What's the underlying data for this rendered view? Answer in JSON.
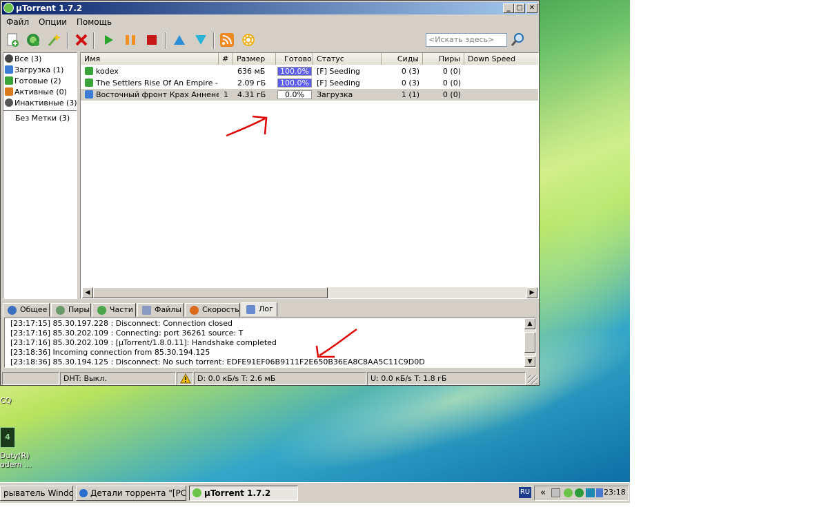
{
  "window": {
    "title": "µTorrent 1.7.2",
    "minimize": "_",
    "maximize": "□",
    "close": "✕"
  },
  "menu": [
    "Файл",
    "Опции",
    "Помощь"
  ],
  "toolbar": {
    "search_placeholder": "<Искать здесь>",
    "icons": [
      "add-torrent-icon",
      "add-url-icon",
      "create-torrent-icon",
      "remove-icon",
      "start-icon",
      "pause-icon",
      "stop-icon",
      "move-up-icon",
      "move-down-icon",
      "rss-icon",
      "settings-icon",
      "search-icon"
    ]
  },
  "sidebar": {
    "items": [
      {
        "label": "Все (3)",
        "color": "#444444"
      },
      {
        "label": "Загрузка (1)",
        "color": "#3a7bd5"
      },
      {
        "label": "Готовые (2)",
        "color": "#3aa43a"
      },
      {
        "label": "Активные (0)",
        "color": "#d97a1c"
      },
      {
        "label": "Инактивные (3)",
        "color": "#555555"
      }
    ],
    "labels_item": "Без Метки (3)"
  },
  "torrents": {
    "columns": [
      "Имя",
      "#",
      "Размер",
      "Готово",
      "Статус",
      "Сиды",
      "Пиры",
      "Down Speed"
    ],
    "rows": [
      {
        "name": "kodex",
        "num": "",
        "size": "636 мБ",
        "done": "100.0%",
        "done_fraction": 1.0,
        "status": "[F] Seeding",
        "seeds": "0 (3)",
        "peers": "0 (0)",
        "icon": "seeding-icon"
      },
      {
        "name": "The Settlers Rise Of An Empire - T...",
        "num": "",
        "size": "2.09 гБ",
        "done": "100.0%",
        "done_fraction": 1.0,
        "status": "[F] Seeding",
        "seeds": "0 (3)",
        "peers": "0 (0)",
        "icon": "seeding-icon"
      },
      {
        "name": "Восточный фронт Крах Анненербе",
        "num": "1",
        "size": "4.31 гБ",
        "done": "0.0%",
        "done_fraction": 0.0,
        "status": "Загрузка",
        "seeds": "1 (1)",
        "peers": "0 (0)",
        "icon": "downloading-icon"
      }
    ]
  },
  "tabs": [
    "Общее",
    "Пиры",
    "Части",
    "Файлы",
    "Скорость",
    "Лог"
  ],
  "log": [
    "[23:17:15]  85.30.197.228   : Disconnect: Connection closed",
    "[23:17:16]  85.30.202.109   : Connecting: port 36261 source: T",
    "[23:17:16]  85.30.202.109   : [µTorrent/1.8.0.11]: Handshake completed",
    "[23:18:36]  Incoming connection from 85.30.194.125",
    "[23:18:36]  85.30.194.125   : Disconnect: No such torrent: EDFE91EF06B9111F2E650B36EA8C8AA5C11C9D0D"
  ],
  "statusbar": {
    "dht": "DHT: Выкл.",
    "down": "D: 0.0 кБ/s T: 2.6 мБ",
    "up": "U: 0.0 кБ/s T: 1.8 гБ"
  },
  "desktop": {
    "icq_label": "CQ",
    "cod_label_1": "Duty(R)",
    "cod_label_2": "odern ..."
  },
  "taskbar": {
    "buttons": [
      "рыватель Windo...",
      "Детали торрента \"[PC] ...",
      "µTorrent 1.7.2"
    ],
    "lang": "RU",
    "chevron": "«",
    "clock": "23:18"
  },
  "colors": {
    "title_start": "#0a246a",
    "title_end": "#a6caf0",
    "progress": "#5c5cf0",
    "annotation": "#e00000"
  }
}
